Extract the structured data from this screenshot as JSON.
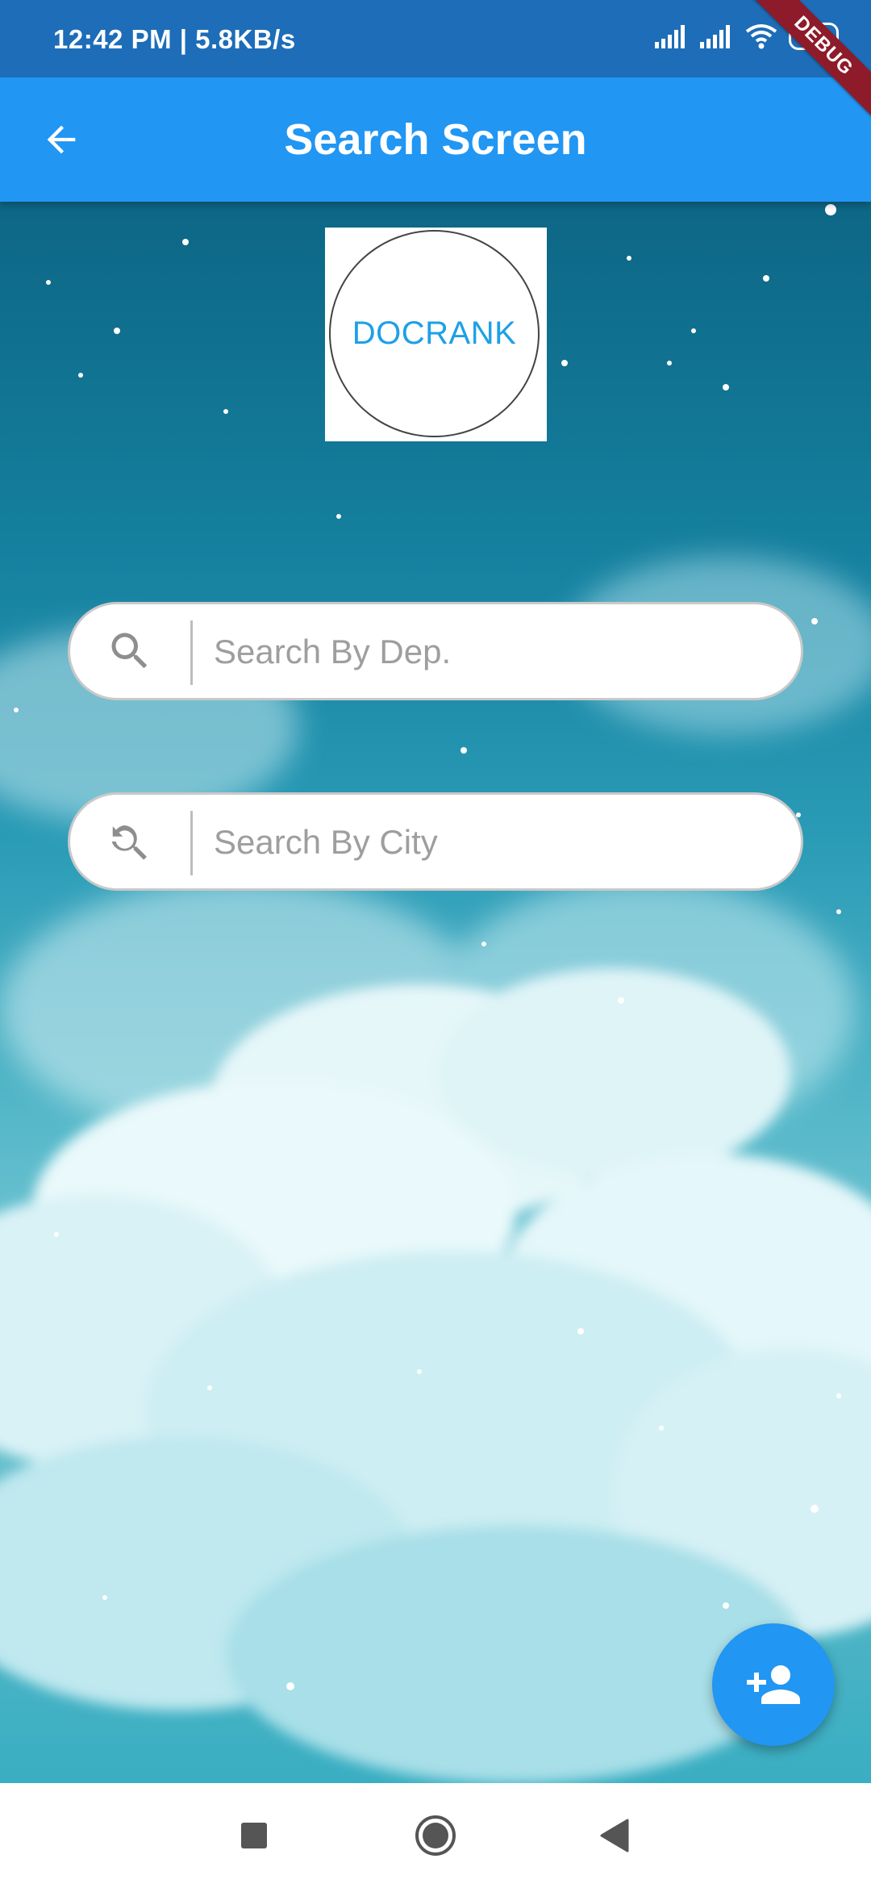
{
  "status_bar": {
    "time": "12:42 PM | 5.8KB/s",
    "battery": "32"
  },
  "debug_banner": "DEBUG",
  "app_bar": {
    "title": "Search Screen",
    "back_icon": "arrow-back-icon"
  },
  "logo": {
    "text": "DOCRANK"
  },
  "search": {
    "department": {
      "placeholder": "Search By Dep.",
      "value": "",
      "icon": "search-icon"
    },
    "city": {
      "placeholder": "Search By City",
      "value": "",
      "icon": "search-refresh-icon"
    }
  },
  "fab": {
    "icon": "person-add-icon"
  },
  "nav": {
    "recents_icon": "square-icon",
    "home_icon": "circle-icon",
    "back_icon": "triangle-back-icon"
  },
  "colors": {
    "app_bar": "#2196f3",
    "status_bar": "#1d6db8",
    "fab": "#2196f3",
    "logo_text": "#1ea0e6",
    "debug": "#8e1b2a"
  }
}
